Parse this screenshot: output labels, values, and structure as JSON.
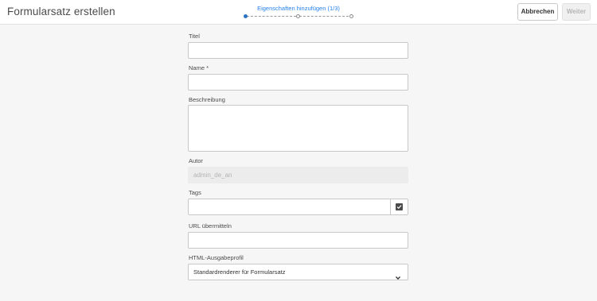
{
  "header": {
    "title": "Formularsatz erstellen",
    "wizard_step_label": "Eigenschaften hinzufügen (1/3)",
    "cancel_label": "Abbrechen",
    "next_label": "Weiter"
  },
  "form": {
    "title": {
      "label": "Titel",
      "value": ""
    },
    "name": {
      "label": "Name *",
      "value": ""
    },
    "description": {
      "label": "Beschreibung",
      "value": ""
    },
    "author": {
      "label": "Autor",
      "value": "admin_de_an"
    },
    "tags": {
      "label": "Tags",
      "value": "",
      "picker_icon": "check-square-icon"
    },
    "submit_url": {
      "label": "URL übermitteln",
      "value": ""
    },
    "html_profile": {
      "label": "HTML-Ausgabeprofil",
      "selected": "Standardrenderer für Formularsatz"
    }
  },
  "colors": {
    "accent": "#2680eb",
    "active_step": "#2d72c4",
    "background": "#f6f6f6"
  }
}
